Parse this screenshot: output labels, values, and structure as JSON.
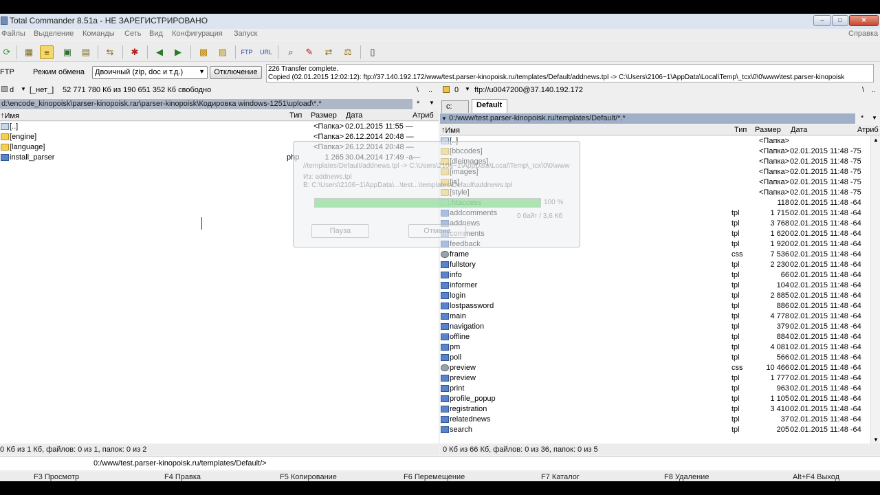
{
  "window": {
    "title": "Total Commander 8.51a - НЕ ЗАРЕГИСТРИРОВАНО"
  },
  "menu": [
    "Файлы",
    "Выделение",
    "Команды",
    "Сеть",
    "Вид",
    "Конфигурация",
    "Запуск"
  ],
  "menu_right": "Справка",
  "ftp": {
    "label": "FTP",
    "mode_label": "Режим обмена",
    "mode_value": "Двоичный (zip, doc и т.д.)",
    "disconnect_label": "Отключение",
    "log_line1": "226 Transfer complete.",
    "log_line2": "Copied (02.01.2015 12:02:12): ftp://37.140.192.172/www/test.parser-kinopoisk.ru/templates/Default/addnews.tpl -> C:\\Users\\2106~1\\AppData\\Local\\Temp\\_tcx\\0\\0\\www\\test.parser-kinopoisk"
  },
  "left": {
    "drive": "d",
    "drive_label": "[_нет_]",
    "free": "52 771 780 Кб из 190 651 352 Кб свободно",
    "root_btn": "\\",
    "up_btn": "..",
    "path": "d:\\encode_kinopoisk\\parser-kinopoisk.rar\\parser-kinopoisk\\Кодировка windows-1251\\upload\\*.*",
    "star": "*",
    "cols": {
      "name": "Имя",
      "ext": "Тип",
      "size": "Размер",
      "date": "Дата",
      "attr": "Атриб"
    },
    "files": [
      {
        "icon": "up",
        "name": "[..]",
        "ext": "",
        "size": "<Папка>",
        "date": "02.01.2015 11:55 —"
      },
      {
        "icon": "folder",
        "name": "[engine]",
        "ext": "",
        "size": "<Папка>",
        "date": "26.12.2014 20:48 —"
      },
      {
        "icon": "folder",
        "name": "[language]",
        "ext": "",
        "size": "<Папка>",
        "date": "26.12.2014 20:48 —"
      },
      {
        "icon": "file",
        "name": "install_parser",
        "ext": "php",
        "size": "1 265",
        "date": "30.04.2014 17:49 -a—"
      }
    ],
    "status": "0 Кб из 1 Кб, файлов: 0 из 1, папок: 0 из 2"
  },
  "right": {
    "drive": "0",
    "drive_label": "ftp://u0047200@37.140.192.172",
    "root_btn": "\\",
    "up_btn": "..",
    "tabs": [
      "c:",
      "Default"
    ],
    "path": "0:/www/test.parser-kinopoisk.ru/templates/Default/*.*",
    "star": "*",
    "cols": {
      "name": "Имя",
      "ext": "Тип",
      "size": "Размер",
      "date": "Дата",
      "attr": "Атриб"
    },
    "files": [
      {
        "icon": "up",
        "name": "[..]",
        "ext": "",
        "size": "<Папка>",
        "date": ""
      },
      {
        "icon": "folder",
        "name": "[bbcodes]",
        "ext": "",
        "size": "<Папка>",
        "date": "02.01.2015 11:48 -75"
      },
      {
        "icon": "folder",
        "name": "[dleimages]",
        "ext": "",
        "size": "<Папка>",
        "date": "02.01.2015 11:48 -75"
      },
      {
        "icon": "folder",
        "name": "[images]",
        "ext": "",
        "size": "<Папка>",
        "date": "02.01.2015 11:48 -75"
      },
      {
        "icon": "folder",
        "name": "[js]",
        "ext": "",
        "size": "<Папка>",
        "date": "02.01.2015 11:48 -75"
      },
      {
        "icon": "folder",
        "name": "[style]",
        "ext": "",
        "size": "<Папка>",
        "date": "02.01.2015 11:48 -75"
      },
      {
        "icon": "doc",
        "name": ".htaccess",
        "ext": "",
        "size": "118",
        "date": "02.01.2015 11:48 -64"
      },
      {
        "icon": "file",
        "name": "addcomments",
        "ext": "tpl",
        "size": "1 715",
        "date": "02.01.2015 11:48 -64"
      },
      {
        "icon": "file",
        "name": "addnews",
        "ext": "tpl",
        "size": "3 768",
        "date": "02.01.2015 11:48 -64"
      },
      {
        "icon": "file",
        "name": "comments",
        "ext": "tpl",
        "size": "1 620",
        "date": "02.01.2015 11:48 -64"
      },
      {
        "icon": "file",
        "name": "feedback",
        "ext": "tpl",
        "size": "1 920",
        "date": "02.01.2015 11:48 -64"
      },
      {
        "icon": "gear",
        "name": "frame",
        "ext": "css",
        "size": "7 536",
        "date": "02.01.2015 11:48 -64"
      },
      {
        "icon": "file",
        "name": "fullstory",
        "ext": "tpl",
        "size": "2 230",
        "date": "02.01.2015 11:48 -64"
      },
      {
        "icon": "file",
        "name": "info",
        "ext": "tpl",
        "size": "66",
        "date": "02.01.2015 11:48 -64"
      },
      {
        "icon": "file",
        "name": "informer",
        "ext": "tpl",
        "size": "104",
        "date": "02.01.2015 11:48 -64"
      },
      {
        "icon": "file",
        "name": "login",
        "ext": "tpl",
        "size": "2 885",
        "date": "02.01.2015 11:48 -64"
      },
      {
        "icon": "file",
        "name": "lostpassword",
        "ext": "tpl",
        "size": "886",
        "date": "02.01.2015 11:48 -64"
      },
      {
        "icon": "file",
        "name": "main",
        "ext": "tpl",
        "size": "4 778",
        "date": "02.01.2015 11:48 -64"
      },
      {
        "icon": "file",
        "name": "navigation",
        "ext": "tpl",
        "size": "379",
        "date": "02.01.2015 11:48 -64"
      },
      {
        "icon": "file",
        "name": "offline",
        "ext": "tpl",
        "size": "884",
        "date": "02.01.2015 11:48 -64"
      },
      {
        "icon": "file",
        "name": "pm",
        "ext": "tpl",
        "size": "4 081",
        "date": "02.01.2015 11:48 -64"
      },
      {
        "icon": "file",
        "name": "poll",
        "ext": "tpl",
        "size": "566",
        "date": "02.01.2015 11:48 -64"
      },
      {
        "icon": "gear",
        "name": "preview",
        "ext": "css",
        "size": "10 466",
        "date": "02.01.2015 11:48 -64"
      },
      {
        "icon": "file",
        "name": "preview",
        "ext": "tpl",
        "size": "1 777",
        "date": "02.01.2015 11:48 -64"
      },
      {
        "icon": "file",
        "name": "print",
        "ext": "tpl",
        "size": "963",
        "date": "02.01.2015 11:48 -64"
      },
      {
        "icon": "file",
        "name": "profile_popup",
        "ext": "tpl",
        "size": "1 105",
        "date": "02.01.2015 11:48 -64"
      },
      {
        "icon": "file",
        "name": "registration",
        "ext": "tpl",
        "size": "3 410",
        "date": "02.01.2015 11:48 -64"
      },
      {
        "icon": "file",
        "name": "relatednews",
        "ext": "tpl",
        "size": "37",
        "date": "02.01.2015 11:48 -64"
      },
      {
        "icon": "file",
        "name": "search",
        "ext": "tpl",
        "size": "205",
        "date": "02.01.2015 11:48 -64"
      }
    ],
    "status": "0 Кб из 66 Кб, файлов: 0 из 36, папок: 0 из 5"
  },
  "dialog": {
    "line1": "//templates/Default/addnews.tpl -> C:\\Users\\2106~1\\AppData\\Local\\Temp\\_tcx\\0\\0\\www",
    "line2": "Из:  addnews.tpl",
    "line3": "В:  C:\\Users\\2106~1\\AppData\\...\\test...\\templates\\Default\\addnews.tpl",
    "percent": "100 %",
    "progress": 1.0,
    "bytes": "0 байт / 3,6 Кб",
    "pause": "Пауза",
    "cancel": "Отмена"
  },
  "cmdline": "0:/www/test.parser-kinopoisk.ru/templates/Default/>",
  "fkeys": [
    "F3 Просмотр",
    "F4 Правка",
    "F5 Копирование",
    "F6 Перемещение",
    "F7 Каталог",
    "F8 Удаление",
    "Alt+F4 Выход"
  ]
}
